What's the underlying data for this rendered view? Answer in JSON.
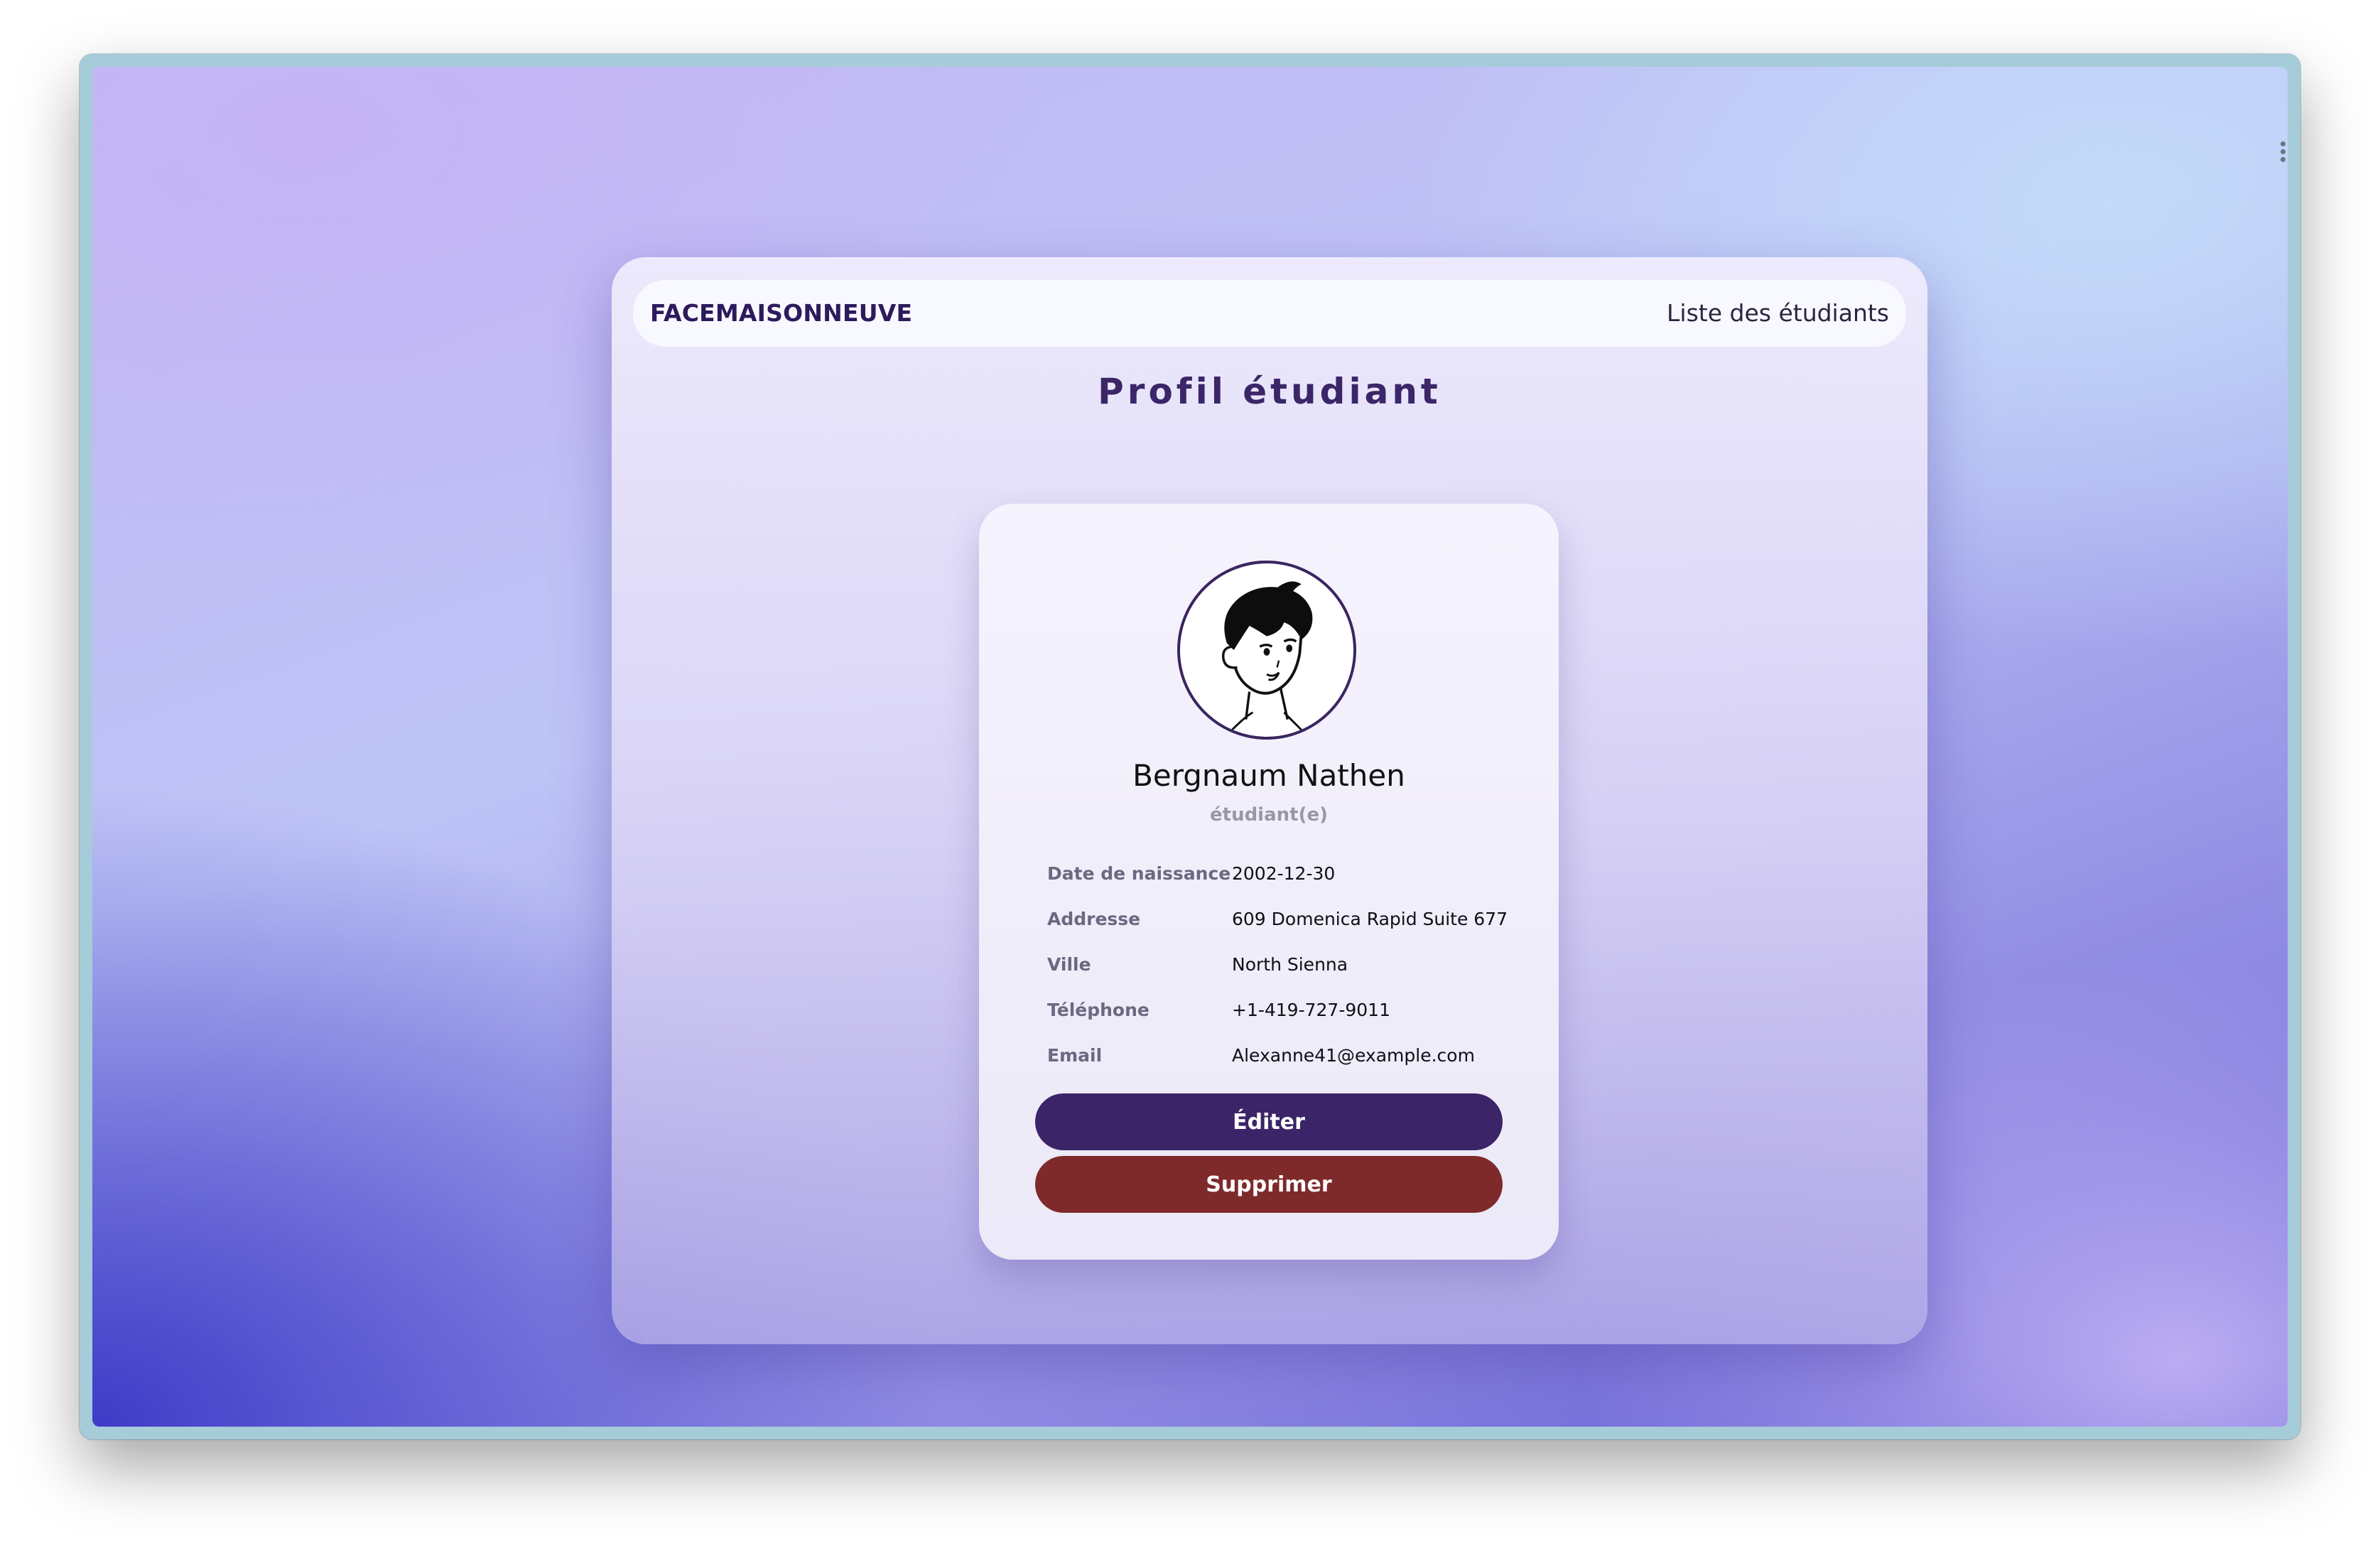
{
  "navbar": {
    "brand": "FACEMAISONNEUVE",
    "link": "Liste des étudiants"
  },
  "page": {
    "title": "Profil étudiant"
  },
  "profile": {
    "name": "Bergnaum Nathen",
    "role": "étudiant(e)",
    "avatar_icon": "cartoon-avatar-icon",
    "fields": [
      {
        "label": "Date de naissance",
        "value": "2002-12-30"
      },
      {
        "label": "Addresse",
        "value": "609 Domenica Rapid Suite 677"
      },
      {
        "label": "Ville",
        "value": "North Sienna"
      },
      {
        "label": "Téléphone",
        "value": "+1-419-727-9011"
      },
      {
        "label": "Email",
        "value": "Alexanne41@example.com"
      }
    ]
  },
  "actions": {
    "edit_label": "Éditer",
    "delete_label": "Supprimer"
  },
  "colors": {
    "primary": "#3b2467",
    "danger": "#7e2a2a",
    "brand_text": "#2d1a5c"
  }
}
